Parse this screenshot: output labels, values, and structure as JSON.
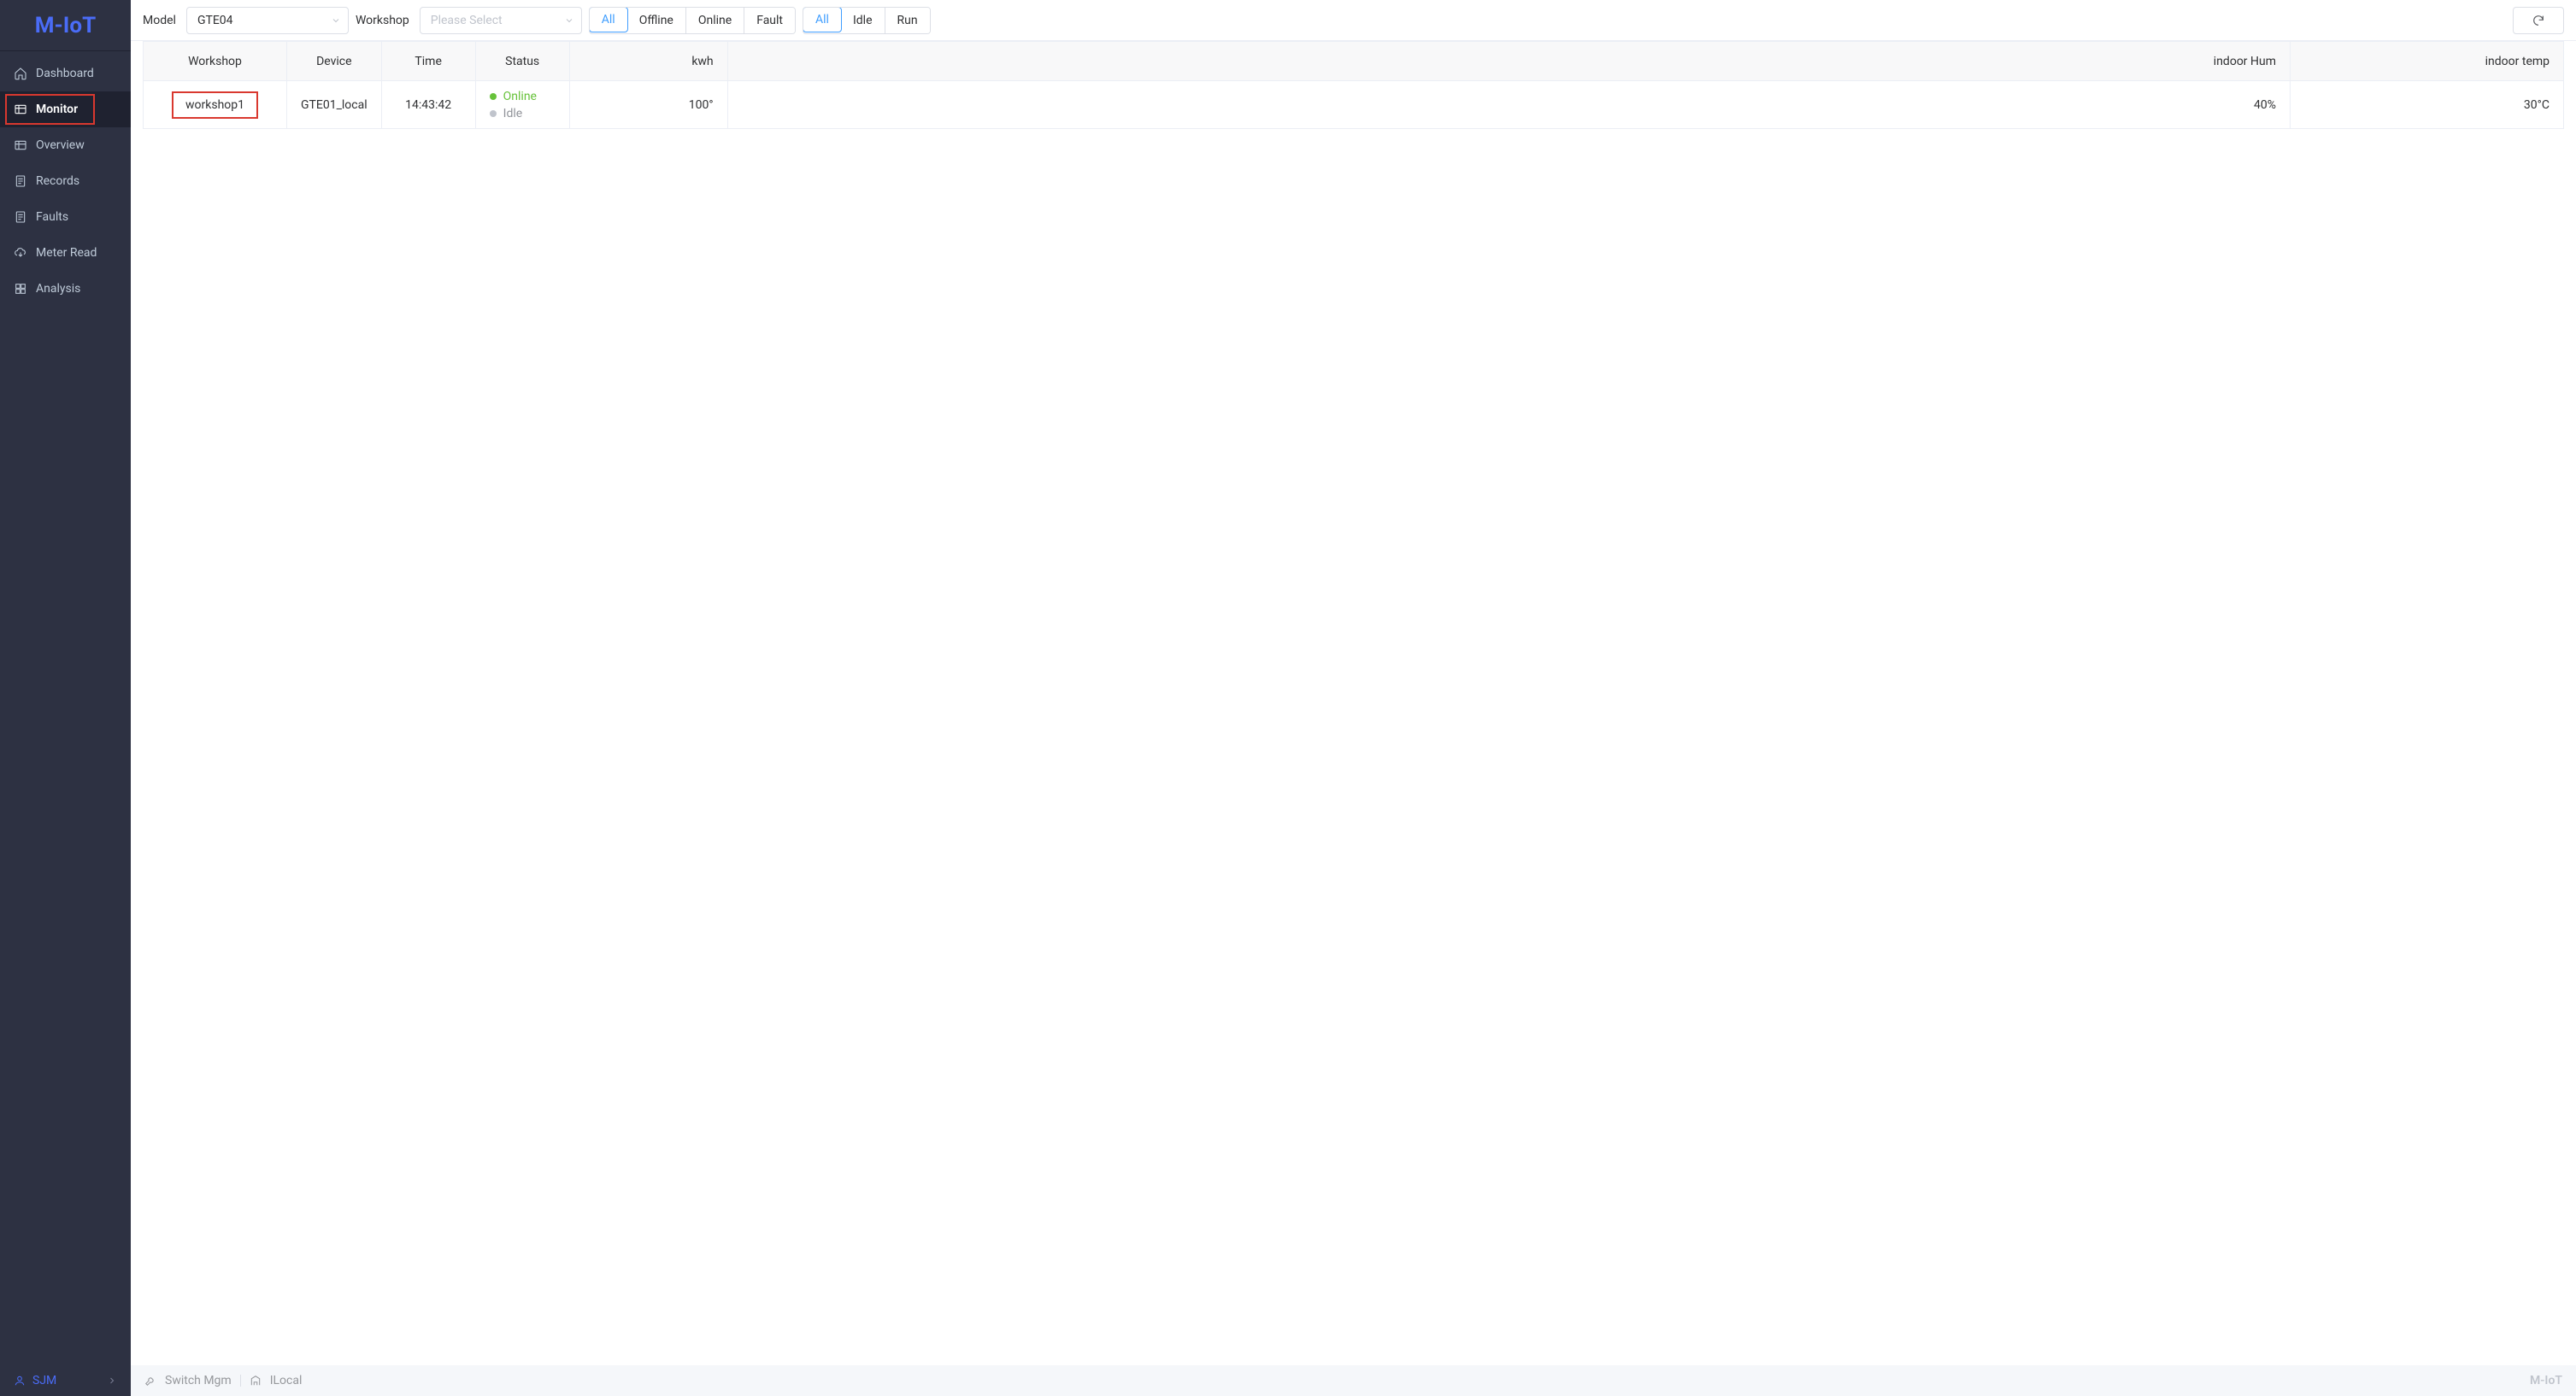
{
  "brand": "M-IoT",
  "sidebar": {
    "items": [
      {
        "label": "Dashboard"
      },
      {
        "label": "Monitor"
      },
      {
        "label": "Overview"
      },
      {
        "label": "Records"
      },
      {
        "label": "Faults"
      },
      {
        "label": "Meter Read"
      },
      {
        "label": "Analysis"
      }
    ]
  },
  "toolbar": {
    "model_label": "Model",
    "model_value": "GTE04",
    "workshop_label": "Workshop",
    "workshop_placeholder": "Please Select",
    "filter1": {
      "options": [
        "All",
        "Offline",
        "Online",
        "Fault"
      ],
      "active": "All"
    },
    "filter2": {
      "options": [
        "All",
        "Idle",
        "Run"
      ],
      "active": "All"
    }
  },
  "table": {
    "headers": {
      "workshop": "Workshop",
      "device": "Device",
      "time": "Time",
      "status": "Status",
      "kwh": "kwh",
      "indoor_hum": "indoor Hum",
      "indoor_temp": "indoor temp"
    },
    "rows": [
      {
        "workshop": "workshop1",
        "device": "GTE01_local",
        "time": "14:43:42",
        "status_online": "Online",
        "status_idle": "Idle",
        "kwh": "100°",
        "indoor_hum": "40%",
        "indoor_temp": "30°C"
      }
    ]
  },
  "footer": {
    "user": "SJM",
    "switch_mgm": "Switch Mgm",
    "location": "ILocal",
    "brand": "M-IoT"
  }
}
